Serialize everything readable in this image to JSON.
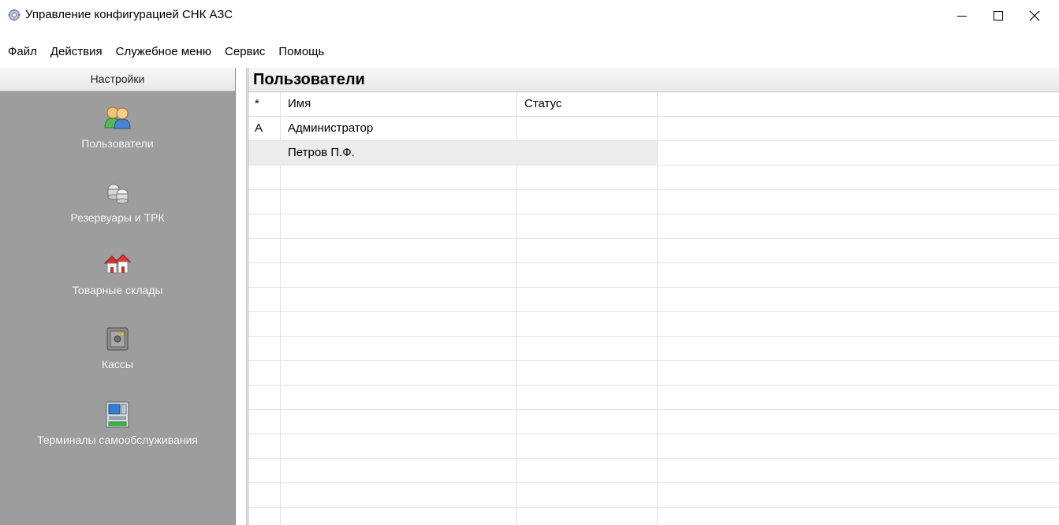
{
  "window": {
    "title": "Управление конфигурацией СНК АЗС",
    "icons": {
      "app": "gear-icon",
      "minimize": "minimize-icon",
      "maximize": "maximize-icon",
      "close": "close-icon"
    }
  },
  "menu": [
    "Файл",
    "Действия",
    "Служебное меню",
    "Сервис",
    "Помощь"
  ],
  "sidebar": {
    "header": "Настройки",
    "items": [
      {
        "label": "Пользователи",
        "icon": "users-icon"
      },
      {
        "label": "Резервуары и ТРК",
        "icon": "tanks-icon"
      },
      {
        "label": "Товарные склады",
        "icon": "warehouse-icon"
      },
      {
        "label": "Кассы",
        "icon": "safe-icon"
      },
      {
        "label": "Терминалы самообслуживания",
        "icon": "terminal-icon"
      }
    ]
  },
  "main": {
    "title": "Пользователи",
    "columns": [
      "*",
      "Имя",
      "Статус"
    ],
    "rows": [
      {
        "mark": "A",
        "name": "Администратор",
        "status": ""
      },
      {
        "mark": "",
        "name": "Петров П.Ф.",
        "status": ""
      }
    ]
  }
}
